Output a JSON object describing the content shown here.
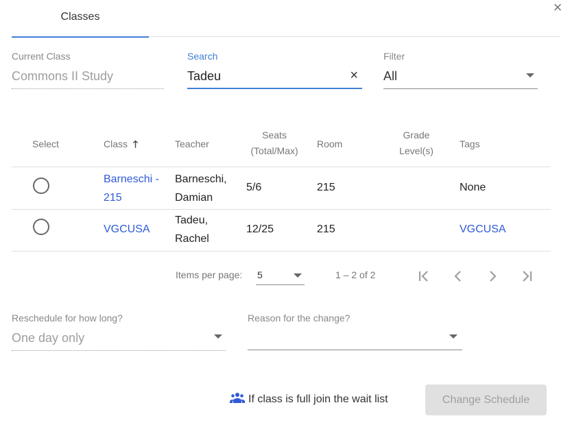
{
  "dialog": {
    "close_icon": "×"
  },
  "tabs": [
    {
      "label": "Classes",
      "active": true
    }
  ],
  "current_class": {
    "label": "Current Class",
    "value": "Commons II Study"
  },
  "search": {
    "label": "Search",
    "value": "Tadeu",
    "clear_icon": "×"
  },
  "filter": {
    "label": "Filter",
    "value": "All"
  },
  "table": {
    "headers": {
      "select": "Select",
      "class": "Class",
      "sort_icon": "🡑",
      "teacher": "Teacher",
      "seats_line1": "Seats",
      "seats_line2": "(Total/Max)",
      "room": "Room",
      "grade_line1": "Grade",
      "grade_line2": "Level(s)",
      "tags": "Tags"
    },
    "rows": [
      {
        "class_line1": "Barneschi -",
        "class_line2": "215",
        "teacher_line1": "Barneschi,",
        "teacher_line2": "Damian",
        "seats": "5/6",
        "room": "215",
        "grade": "",
        "tags": "None"
      },
      {
        "class_line1": "VGCUSA",
        "class_line2": "",
        "teacher_line1": "Tadeu,",
        "teacher_line2": "Rachel",
        "seats": "12/25",
        "room": "215",
        "grade": "",
        "tags": "VGCUSA"
      }
    ]
  },
  "paginator": {
    "items_label": "Items per page:",
    "page_size": "5",
    "range": "1 – 2 of 2",
    "first_icon": "|<",
    "prev_icon": "<",
    "next_icon": ">",
    "last_icon": ">|"
  },
  "reschedule": {
    "label": "Reschedule for how long?",
    "value": "One day only"
  },
  "reason": {
    "label": "Reason for the change?",
    "value": ""
  },
  "waitlist": {
    "label": "If class is full join the wait list",
    "icon": "group-icon"
  },
  "actions": {
    "change_schedule": "Change Schedule"
  },
  "colors": {
    "accent": "#3f7fd6",
    "link": "#2f5bd6",
    "disabled_bg": "#e0e0e0"
  }
}
